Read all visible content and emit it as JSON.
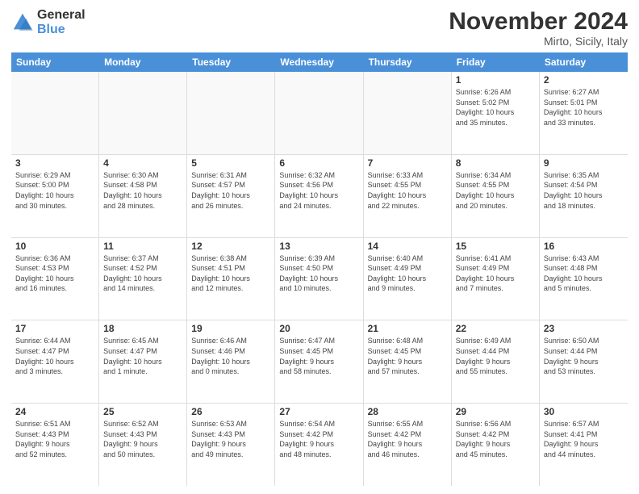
{
  "logo": {
    "line1": "General",
    "line2": "Blue"
  },
  "title": "November 2024",
  "location": "Mirto, Sicily, Italy",
  "header_days": [
    "Sunday",
    "Monday",
    "Tuesday",
    "Wednesday",
    "Thursday",
    "Friday",
    "Saturday"
  ],
  "weeks": [
    [
      {
        "day": "",
        "info": "",
        "empty": true
      },
      {
        "day": "",
        "info": "",
        "empty": true
      },
      {
        "day": "",
        "info": "",
        "empty": true
      },
      {
        "day": "",
        "info": "",
        "empty": true
      },
      {
        "day": "",
        "info": "",
        "empty": true
      },
      {
        "day": "1",
        "info": "Sunrise: 6:26 AM\nSunset: 5:02 PM\nDaylight: 10 hours\nand 35 minutes.",
        "empty": false
      },
      {
        "day": "2",
        "info": "Sunrise: 6:27 AM\nSunset: 5:01 PM\nDaylight: 10 hours\nand 33 minutes.",
        "empty": false
      }
    ],
    [
      {
        "day": "3",
        "info": "Sunrise: 6:29 AM\nSunset: 5:00 PM\nDaylight: 10 hours\nand 30 minutes.",
        "empty": false
      },
      {
        "day": "4",
        "info": "Sunrise: 6:30 AM\nSunset: 4:58 PM\nDaylight: 10 hours\nand 28 minutes.",
        "empty": false
      },
      {
        "day": "5",
        "info": "Sunrise: 6:31 AM\nSunset: 4:57 PM\nDaylight: 10 hours\nand 26 minutes.",
        "empty": false
      },
      {
        "day": "6",
        "info": "Sunrise: 6:32 AM\nSunset: 4:56 PM\nDaylight: 10 hours\nand 24 minutes.",
        "empty": false
      },
      {
        "day": "7",
        "info": "Sunrise: 6:33 AM\nSunset: 4:55 PM\nDaylight: 10 hours\nand 22 minutes.",
        "empty": false
      },
      {
        "day": "8",
        "info": "Sunrise: 6:34 AM\nSunset: 4:55 PM\nDaylight: 10 hours\nand 20 minutes.",
        "empty": false
      },
      {
        "day": "9",
        "info": "Sunrise: 6:35 AM\nSunset: 4:54 PM\nDaylight: 10 hours\nand 18 minutes.",
        "empty": false
      }
    ],
    [
      {
        "day": "10",
        "info": "Sunrise: 6:36 AM\nSunset: 4:53 PM\nDaylight: 10 hours\nand 16 minutes.",
        "empty": false
      },
      {
        "day": "11",
        "info": "Sunrise: 6:37 AM\nSunset: 4:52 PM\nDaylight: 10 hours\nand 14 minutes.",
        "empty": false
      },
      {
        "day": "12",
        "info": "Sunrise: 6:38 AM\nSunset: 4:51 PM\nDaylight: 10 hours\nand 12 minutes.",
        "empty": false
      },
      {
        "day": "13",
        "info": "Sunrise: 6:39 AM\nSunset: 4:50 PM\nDaylight: 10 hours\nand 10 minutes.",
        "empty": false
      },
      {
        "day": "14",
        "info": "Sunrise: 6:40 AM\nSunset: 4:49 PM\nDaylight: 10 hours\nand 9 minutes.",
        "empty": false
      },
      {
        "day": "15",
        "info": "Sunrise: 6:41 AM\nSunset: 4:49 PM\nDaylight: 10 hours\nand 7 minutes.",
        "empty": false
      },
      {
        "day": "16",
        "info": "Sunrise: 6:43 AM\nSunset: 4:48 PM\nDaylight: 10 hours\nand 5 minutes.",
        "empty": false
      }
    ],
    [
      {
        "day": "17",
        "info": "Sunrise: 6:44 AM\nSunset: 4:47 PM\nDaylight: 10 hours\nand 3 minutes.",
        "empty": false
      },
      {
        "day": "18",
        "info": "Sunrise: 6:45 AM\nSunset: 4:47 PM\nDaylight: 10 hours\nand 1 minute.",
        "empty": false
      },
      {
        "day": "19",
        "info": "Sunrise: 6:46 AM\nSunset: 4:46 PM\nDaylight: 10 hours\nand 0 minutes.",
        "empty": false
      },
      {
        "day": "20",
        "info": "Sunrise: 6:47 AM\nSunset: 4:45 PM\nDaylight: 9 hours\nand 58 minutes.",
        "empty": false
      },
      {
        "day": "21",
        "info": "Sunrise: 6:48 AM\nSunset: 4:45 PM\nDaylight: 9 hours\nand 57 minutes.",
        "empty": false
      },
      {
        "day": "22",
        "info": "Sunrise: 6:49 AM\nSunset: 4:44 PM\nDaylight: 9 hours\nand 55 minutes.",
        "empty": false
      },
      {
        "day": "23",
        "info": "Sunrise: 6:50 AM\nSunset: 4:44 PM\nDaylight: 9 hours\nand 53 minutes.",
        "empty": false
      }
    ],
    [
      {
        "day": "24",
        "info": "Sunrise: 6:51 AM\nSunset: 4:43 PM\nDaylight: 9 hours\nand 52 minutes.",
        "empty": false
      },
      {
        "day": "25",
        "info": "Sunrise: 6:52 AM\nSunset: 4:43 PM\nDaylight: 9 hours\nand 50 minutes.",
        "empty": false
      },
      {
        "day": "26",
        "info": "Sunrise: 6:53 AM\nSunset: 4:43 PM\nDaylight: 9 hours\nand 49 minutes.",
        "empty": false
      },
      {
        "day": "27",
        "info": "Sunrise: 6:54 AM\nSunset: 4:42 PM\nDaylight: 9 hours\nand 48 minutes.",
        "empty": false
      },
      {
        "day": "28",
        "info": "Sunrise: 6:55 AM\nSunset: 4:42 PM\nDaylight: 9 hours\nand 46 minutes.",
        "empty": false
      },
      {
        "day": "29",
        "info": "Sunrise: 6:56 AM\nSunset: 4:42 PM\nDaylight: 9 hours\nand 45 minutes.",
        "empty": false
      },
      {
        "day": "30",
        "info": "Sunrise: 6:57 AM\nSunset: 4:41 PM\nDaylight: 9 hours\nand 44 minutes.",
        "empty": false
      }
    ]
  ]
}
